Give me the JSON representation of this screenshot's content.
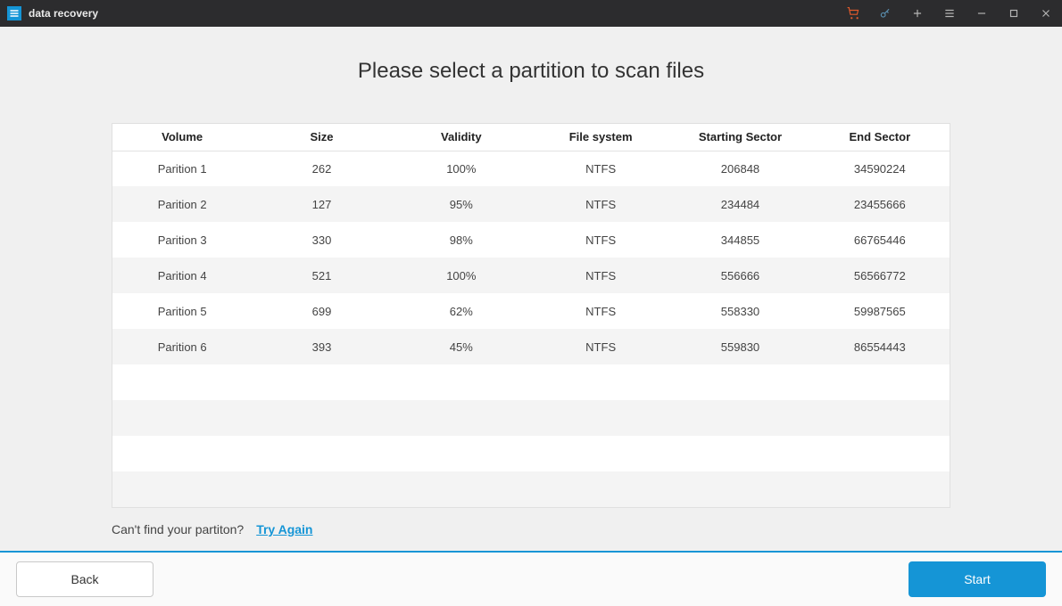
{
  "titlebar": {
    "app_name": "data recovery"
  },
  "main": {
    "heading": "Please select a partition to scan files",
    "columns": {
      "volume": "Volume",
      "size": "Size",
      "validity": "Validity",
      "filesystem": "File system",
      "start_sector": "Starting Sector",
      "end_sector": "End Sector"
    },
    "rows": [
      {
        "volume": "Parition 1",
        "size": "262",
        "validity": "100%",
        "filesystem": "NTFS",
        "start_sector": "206848",
        "end_sector": "34590224"
      },
      {
        "volume": "Parition 2",
        "size": "127",
        "validity": "95%",
        "filesystem": "NTFS",
        "start_sector": "234484",
        "end_sector": "23455666"
      },
      {
        "volume": "Parition 3",
        "size": "330",
        "validity": "98%",
        "filesystem": "NTFS",
        "start_sector": "344855",
        "end_sector": "66765446"
      },
      {
        "volume": "Parition 4",
        "size": "521",
        "validity": "100%",
        "filesystem": "NTFS",
        "start_sector": "556666",
        "end_sector": "56566772"
      },
      {
        "volume": "Parition 5",
        "size": "699",
        "validity": "62%",
        "filesystem": "NTFS",
        "start_sector": "558330",
        "end_sector": "59987565"
      },
      {
        "volume": "Parition 6",
        "size": "393",
        "validity": "45%",
        "filesystem": "NTFS",
        "start_sector": "559830",
        "end_sector": "86554443"
      }
    ],
    "empty_rows": 4,
    "hint_text": "Can't find your partiton?",
    "try_again": "Try Again"
  },
  "footer": {
    "back": "Back",
    "start": "Start"
  }
}
